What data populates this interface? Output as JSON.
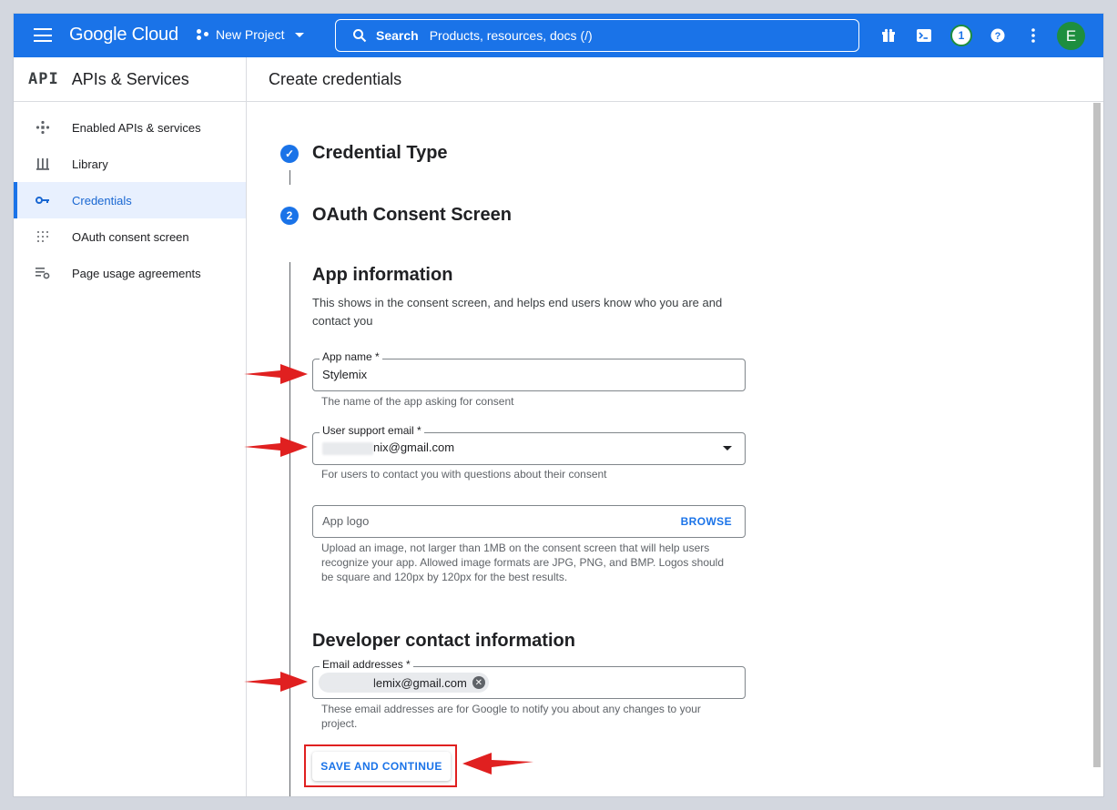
{
  "colors": {
    "brand": "#1a73e8",
    "annotation": "#e02020",
    "avatar": "#1e8e3e"
  },
  "topbar": {
    "logo": "Google Cloud",
    "project": "New Project",
    "search_label": "Search",
    "search_placeholder": "Products, resources, docs (/)",
    "notification_count": "1",
    "avatar_letter": "E",
    "icons": [
      "menu-icon",
      "gift-icon",
      "cloud-shell-icon",
      "help-icon",
      "more-vert-icon"
    ]
  },
  "sidebar": {
    "api_badge": "API",
    "title": "APIs & Services",
    "items": [
      {
        "label": "Enabled APIs & services",
        "icon": "diamond-dots-icon"
      },
      {
        "label": "Library",
        "icon": "library-icon"
      },
      {
        "label": "Credentials",
        "icon": "key-icon"
      },
      {
        "label": "OAuth consent screen",
        "icon": "consent-dots-icon"
      },
      {
        "label": "Page usage agreements",
        "icon": "settings-list-icon"
      }
    ],
    "active_index": 2
  },
  "main": {
    "page_title": "Create credentials",
    "steps": [
      {
        "number": "✓",
        "title": "Credential Type"
      },
      {
        "number": "2",
        "title": "OAuth Consent Screen"
      }
    ],
    "app_info": {
      "heading": "App information",
      "description": "This shows in the consent screen, and helps end users know who you are and contact you",
      "app_name": {
        "label": "App name *",
        "value": "Stylemix",
        "hint": "The name of the app asking for consent"
      },
      "support_email": {
        "label": "User support email *",
        "value": "nix@gmail.com",
        "hint": "For users to contact you with questions about their consent"
      },
      "app_logo": {
        "placeholder": "App logo",
        "browse": "BROWSE",
        "hint": "Upload an image, not larger than 1MB on the consent screen that will help users recognize your app. Allowed image formats are JPG, PNG, and BMP. Logos should be square and 120px by 120px for the best results."
      }
    },
    "developer": {
      "heading": "Developer contact information",
      "emails": {
        "label": "Email addresses *",
        "chip": "lemix@gmail.com",
        "hint": "These email addresses are for Google to notify you about any changes to your project."
      }
    },
    "save_button": "SAVE AND CONTINUE"
  }
}
